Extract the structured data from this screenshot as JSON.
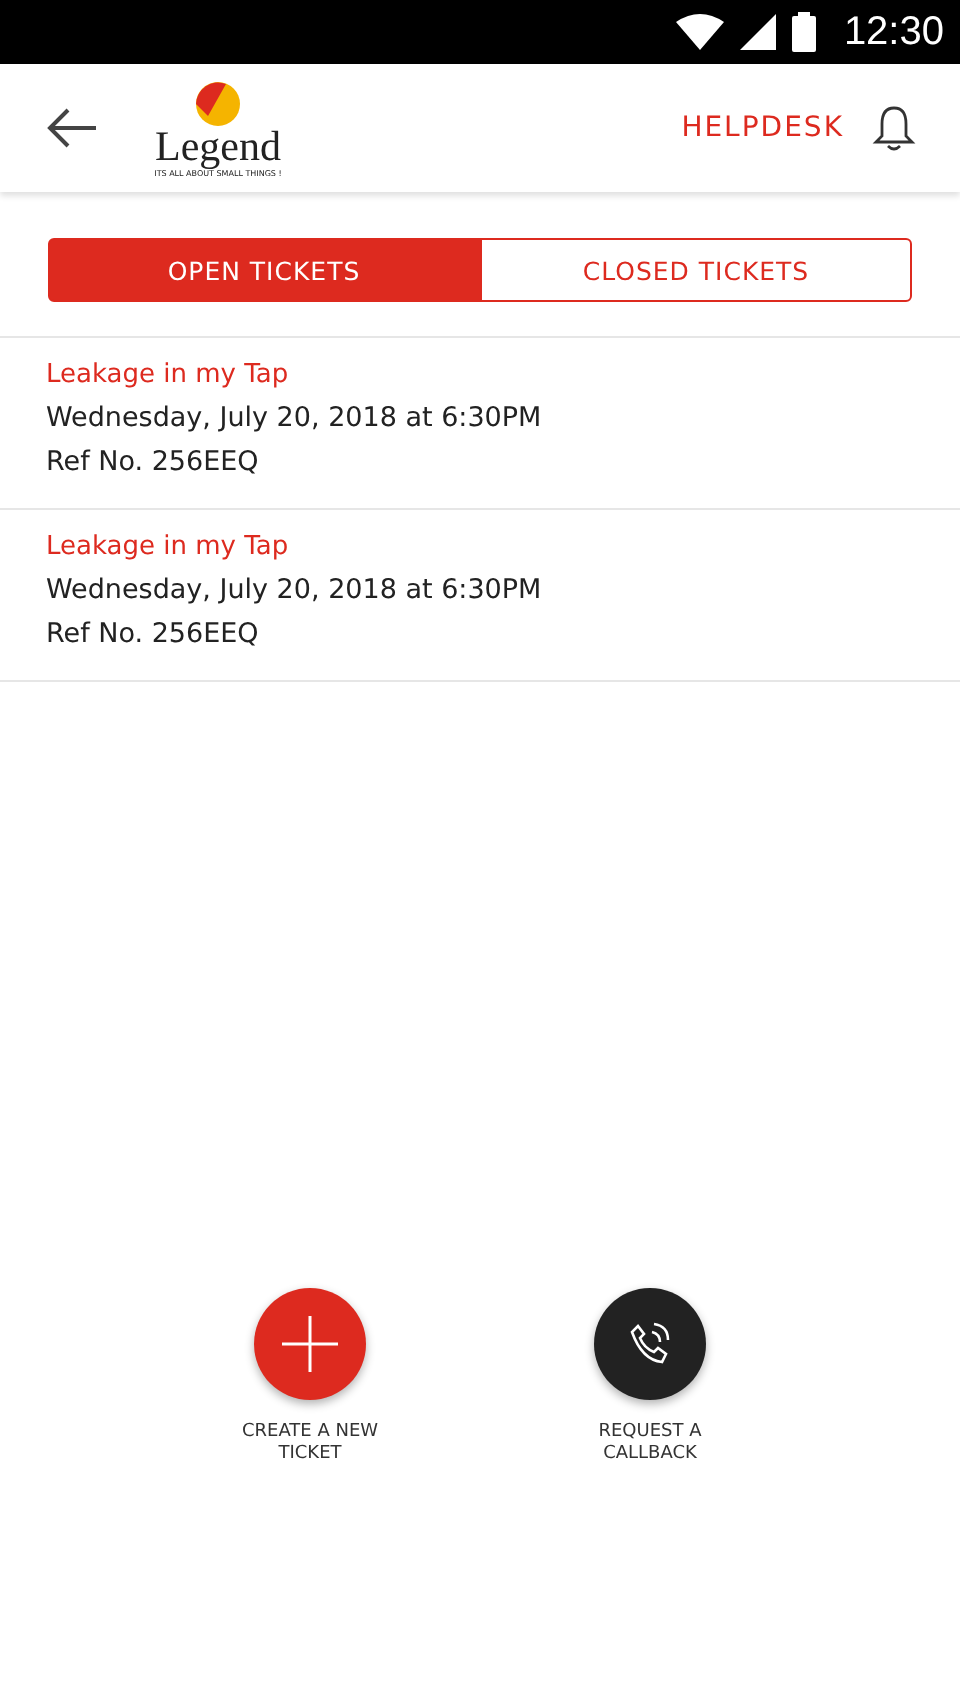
{
  "status_bar": {
    "time": "12:30"
  },
  "header": {
    "logo": {
      "name": "Legend",
      "tagline": "ITS ALL ABOUT SMALL THINGS !"
    },
    "link": "HELPDESK"
  },
  "tabs": [
    {
      "label": "OPEN TICKETS",
      "selected": true
    },
    {
      "label": "CLOSED TICKETS",
      "selected": false
    }
  ],
  "tickets": [
    {
      "title": "Leakage in my Tap",
      "date": "Wednesday, July 20, 2018 at 6:30PM",
      "ref": "Ref No. 256EEQ"
    },
    {
      "title": "Leakage in my Tap",
      "date": "Wednesday, July 20, 2018 at 6:30PM",
      "ref": "Ref No. 256EEQ"
    }
  ],
  "actions": [
    {
      "kind": "create",
      "label": "CREATE A NEW TICKET"
    },
    {
      "kind": "callback",
      "label": "REQUEST A CALLBACK"
    }
  ]
}
